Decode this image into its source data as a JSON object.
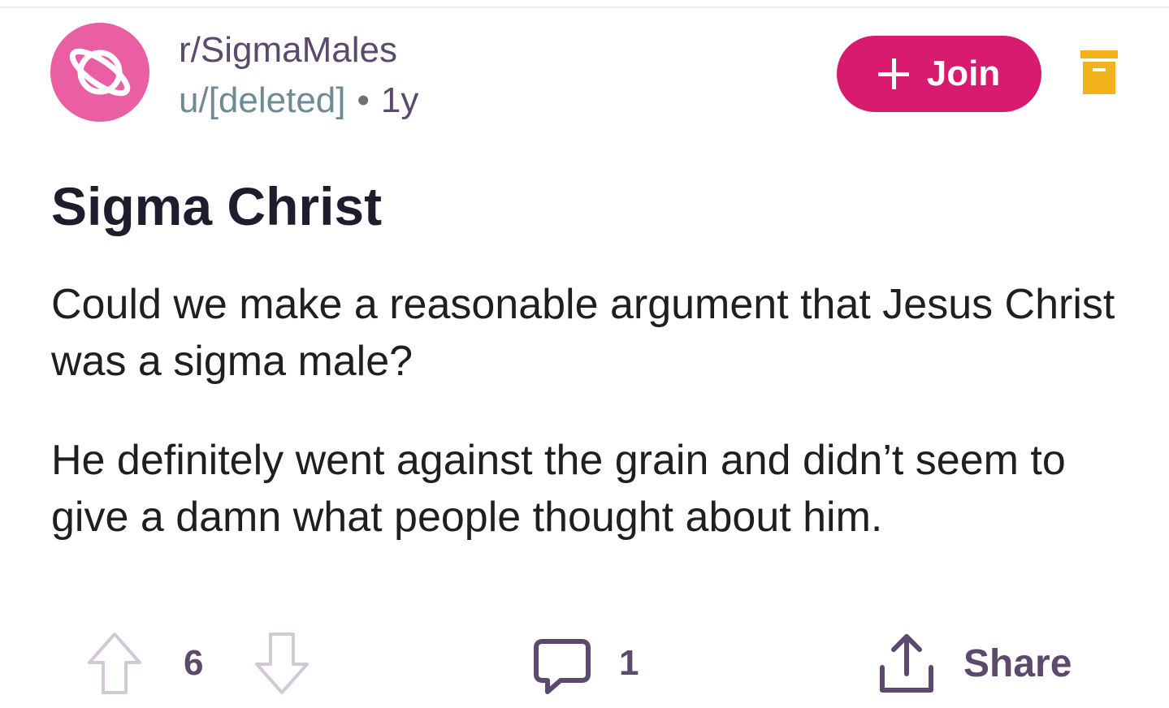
{
  "post": {
    "subreddit": "r/SigmaMales",
    "author": "u/[deleted]",
    "separator": "•",
    "age": "1y",
    "join_label": "Join",
    "title": "Sigma Christ",
    "body": [
      "Could we make a reasonable argument that Jesus Christ was a sigma male?",
      "He definitely went against the grain and didn’t seem to give a damn what people thought about him."
    ]
  },
  "actions": {
    "vote_count": "6",
    "comment_count": "1",
    "share_label": "Share"
  },
  "icons": {
    "avatar": "planet-icon",
    "archive": "archive-icon",
    "upvote": "upvote-arrow-icon",
    "downvote": "downvote-arrow-icon",
    "comment": "comment-bubble-icon",
    "share": "share-icon"
  },
  "colors": {
    "accent": "#d81b6f",
    "avatar_bg": "#ea5ea3",
    "archive": "#f2b21b",
    "text_muted": "#5c4a6e",
    "username": "#6f8a94",
    "title": "#1d1d2e"
  }
}
